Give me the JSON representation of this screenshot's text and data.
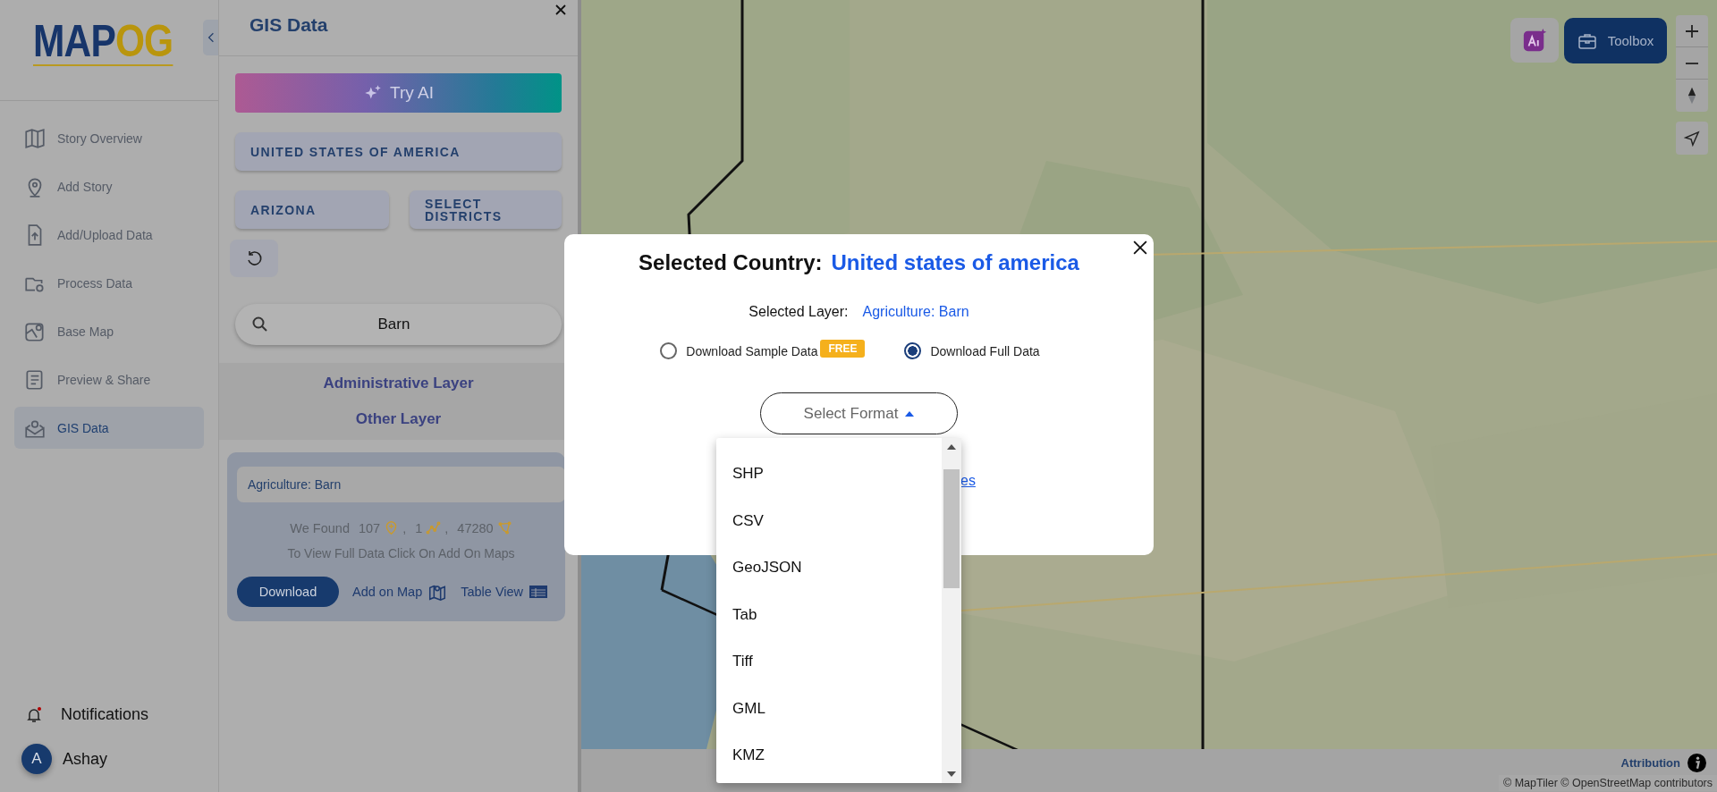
{
  "sidebar": {
    "logo": {
      "part_1": "MAP",
      "part_2": "OG"
    },
    "nav_items": [
      {
        "label": "Story Overview",
        "selected": false
      },
      {
        "label": "Add Story",
        "selected": false
      },
      {
        "label": "Add/Upload Data",
        "selected": false
      },
      {
        "label": "Process Data",
        "selected": false
      },
      {
        "label": "Base Map",
        "selected": false
      },
      {
        "label": "Preview & Share",
        "selected": false
      },
      {
        "label": "GIS Data",
        "selected": true
      }
    ],
    "notifications": {
      "label": "Notifications",
      "unread": true
    },
    "user": {
      "initial": "A",
      "name": "Ashay"
    }
  },
  "gis_panel": {
    "title": "GIS Data",
    "try_ai_button": "Try AI",
    "region_buttons": [
      "UNITED STATES OF AMERICA",
      "ARIZONA",
      "SELECT DISTRICTS"
    ],
    "search": {
      "value": "Barn"
    },
    "layer_sections": [
      "Administrative Layer",
      "Other Layer"
    ],
    "result_card": {
      "layer": "Agriculture: Barn",
      "found_label": "We Found",
      "counts": [
        {
          "value": "107",
          "kind": "point",
          "separator": ","
        },
        {
          "value": "1",
          "kind": "line",
          "separator": ","
        },
        {
          "value": "47280",
          "kind": "polygon"
        }
      ],
      "hint": "To View Full Data Click On Add On Maps",
      "actions": [
        {
          "label": "Download",
          "kind": "primary"
        },
        {
          "label": "Add on Map",
          "kind": "map"
        },
        {
          "label": "Table View",
          "kind": "table"
        }
      ]
    }
  },
  "map": {
    "toolbox_button": "Toolbox",
    "attribution": "Attribution",
    "copyright": "© MapTiler © OpenStreetMap contributors"
  },
  "modal": {
    "title_label": "Selected Country:",
    "country": "United states of america",
    "layer_label": "Selected Layer:",
    "layer": "Agriculture: Barn",
    "options": [
      {
        "label": "Download Sample Data",
        "badge": "FREE",
        "selected": false
      },
      {
        "label": "Download Full Data",
        "selected": true
      }
    ],
    "format_select": {
      "placeholder": "Select Format",
      "expanded": true,
      "options": [
        "SHP",
        "CSV",
        "GeoJSON",
        "Tab",
        "Tiff",
        "GML",
        "KMZ"
      ]
    },
    "link_fragment": "es"
  }
}
